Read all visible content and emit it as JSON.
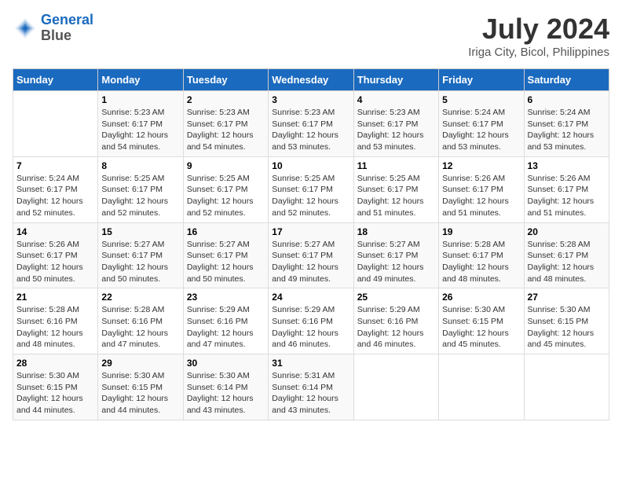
{
  "header": {
    "logo_line1": "General",
    "logo_line2": "Blue",
    "title": "July 2024",
    "subtitle": "Iriga City, Bicol, Philippines"
  },
  "calendar": {
    "weekdays": [
      "Sunday",
      "Monday",
      "Tuesday",
      "Wednesday",
      "Thursday",
      "Friday",
      "Saturday"
    ],
    "weeks": [
      [
        {
          "day": "",
          "sunrise": "",
          "sunset": "",
          "daylight": ""
        },
        {
          "day": "1",
          "sunrise": "Sunrise: 5:23 AM",
          "sunset": "Sunset: 6:17 PM",
          "daylight": "Daylight: 12 hours and 54 minutes."
        },
        {
          "day": "2",
          "sunrise": "Sunrise: 5:23 AM",
          "sunset": "Sunset: 6:17 PM",
          "daylight": "Daylight: 12 hours and 54 minutes."
        },
        {
          "day": "3",
          "sunrise": "Sunrise: 5:23 AM",
          "sunset": "Sunset: 6:17 PM",
          "daylight": "Daylight: 12 hours and 53 minutes."
        },
        {
          "day": "4",
          "sunrise": "Sunrise: 5:23 AM",
          "sunset": "Sunset: 6:17 PM",
          "daylight": "Daylight: 12 hours and 53 minutes."
        },
        {
          "day": "5",
          "sunrise": "Sunrise: 5:24 AM",
          "sunset": "Sunset: 6:17 PM",
          "daylight": "Daylight: 12 hours and 53 minutes."
        },
        {
          "day": "6",
          "sunrise": "Sunrise: 5:24 AM",
          "sunset": "Sunset: 6:17 PM",
          "daylight": "Daylight: 12 hours and 53 minutes."
        }
      ],
      [
        {
          "day": "7",
          "sunrise": "Sunrise: 5:24 AM",
          "sunset": "Sunset: 6:17 PM",
          "daylight": "Daylight: 12 hours and 52 minutes."
        },
        {
          "day": "8",
          "sunrise": "Sunrise: 5:25 AM",
          "sunset": "Sunset: 6:17 PM",
          "daylight": "Daylight: 12 hours and 52 minutes."
        },
        {
          "day": "9",
          "sunrise": "Sunrise: 5:25 AM",
          "sunset": "Sunset: 6:17 PM",
          "daylight": "Daylight: 12 hours and 52 minutes."
        },
        {
          "day": "10",
          "sunrise": "Sunrise: 5:25 AM",
          "sunset": "Sunset: 6:17 PM",
          "daylight": "Daylight: 12 hours and 52 minutes."
        },
        {
          "day": "11",
          "sunrise": "Sunrise: 5:25 AM",
          "sunset": "Sunset: 6:17 PM",
          "daylight": "Daylight: 12 hours and 51 minutes."
        },
        {
          "day": "12",
          "sunrise": "Sunrise: 5:26 AM",
          "sunset": "Sunset: 6:17 PM",
          "daylight": "Daylight: 12 hours and 51 minutes."
        },
        {
          "day": "13",
          "sunrise": "Sunrise: 5:26 AM",
          "sunset": "Sunset: 6:17 PM",
          "daylight": "Daylight: 12 hours and 51 minutes."
        }
      ],
      [
        {
          "day": "14",
          "sunrise": "Sunrise: 5:26 AM",
          "sunset": "Sunset: 6:17 PM",
          "daylight": "Daylight: 12 hours and 50 minutes."
        },
        {
          "day": "15",
          "sunrise": "Sunrise: 5:27 AM",
          "sunset": "Sunset: 6:17 PM",
          "daylight": "Daylight: 12 hours and 50 minutes."
        },
        {
          "day": "16",
          "sunrise": "Sunrise: 5:27 AM",
          "sunset": "Sunset: 6:17 PM",
          "daylight": "Daylight: 12 hours and 50 minutes."
        },
        {
          "day": "17",
          "sunrise": "Sunrise: 5:27 AM",
          "sunset": "Sunset: 6:17 PM",
          "daylight": "Daylight: 12 hours and 49 minutes."
        },
        {
          "day": "18",
          "sunrise": "Sunrise: 5:27 AM",
          "sunset": "Sunset: 6:17 PM",
          "daylight": "Daylight: 12 hours and 49 minutes."
        },
        {
          "day": "19",
          "sunrise": "Sunrise: 5:28 AM",
          "sunset": "Sunset: 6:17 PM",
          "daylight": "Daylight: 12 hours and 48 minutes."
        },
        {
          "day": "20",
          "sunrise": "Sunrise: 5:28 AM",
          "sunset": "Sunset: 6:17 PM",
          "daylight": "Daylight: 12 hours and 48 minutes."
        }
      ],
      [
        {
          "day": "21",
          "sunrise": "Sunrise: 5:28 AM",
          "sunset": "Sunset: 6:16 PM",
          "daylight": "Daylight: 12 hours and 48 minutes."
        },
        {
          "day": "22",
          "sunrise": "Sunrise: 5:28 AM",
          "sunset": "Sunset: 6:16 PM",
          "daylight": "Daylight: 12 hours and 47 minutes."
        },
        {
          "day": "23",
          "sunrise": "Sunrise: 5:29 AM",
          "sunset": "Sunset: 6:16 PM",
          "daylight": "Daylight: 12 hours and 47 minutes."
        },
        {
          "day": "24",
          "sunrise": "Sunrise: 5:29 AM",
          "sunset": "Sunset: 6:16 PM",
          "daylight": "Daylight: 12 hours and 46 minutes."
        },
        {
          "day": "25",
          "sunrise": "Sunrise: 5:29 AM",
          "sunset": "Sunset: 6:16 PM",
          "daylight": "Daylight: 12 hours and 46 minutes."
        },
        {
          "day": "26",
          "sunrise": "Sunrise: 5:30 AM",
          "sunset": "Sunset: 6:15 PM",
          "daylight": "Daylight: 12 hours and 45 minutes."
        },
        {
          "day": "27",
          "sunrise": "Sunrise: 5:30 AM",
          "sunset": "Sunset: 6:15 PM",
          "daylight": "Daylight: 12 hours and 45 minutes."
        }
      ],
      [
        {
          "day": "28",
          "sunrise": "Sunrise: 5:30 AM",
          "sunset": "Sunset: 6:15 PM",
          "daylight": "Daylight: 12 hours and 44 minutes."
        },
        {
          "day": "29",
          "sunrise": "Sunrise: 5:30 AM",
          "sunset": "Sunset: 6:15 PM",
          "daylight": "Daylight: 12 hours and 44 minutes."
        },
        {
          "day": "30",
          "sunrise": "Sunrise: 5:30 AM",
          "sunset": "Sunset: 6:14 PM",
          "daylight": "Daylight: 12 hours and 43 minutes."
        },
        {
          "day": "31",
          "sunrise": "Sunrise: 5:31 AM",
          "sunset": "Sunset: 6:14 PM",
          "daylight": "Daylight: 12 hours and 43 minutes."
        },
        {
          "day": "",
          "sunrise": "",
          "sunset": "",
          "daylight": ""
        },
        {
          "day": "",
          "sunrise": "",
          "sunset": "",
          "daylight": ""
        },
        {
          "day": "",
          "sunrise": "",
          "sunset": "",
          "daylight": ""
        }
      ]
    ]
  }
}
